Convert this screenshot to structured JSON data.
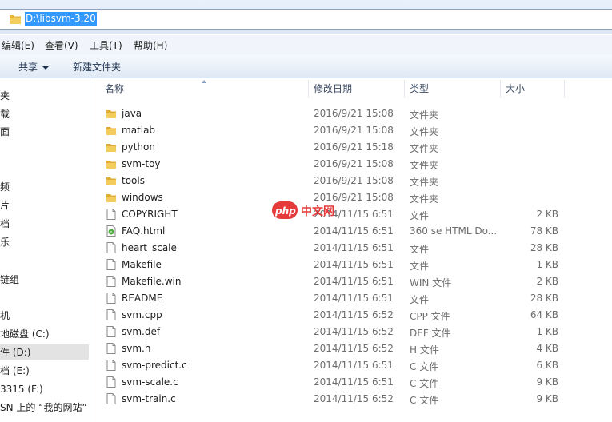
{
  "address": {
    "path": "D:\\libsvm-3.20"
  },
  "menu": [
    "编辑(E)",
    "查看(V)",
    "工具(T)",
    "帮助(H)"
  ],
  "toolbar": {
    "share_label": "共享",
    "new_folder_label": "新建文件夹"
  },
  "nav": [
    "夹",
    "载",
    "面",
    "频",
    "片",
    "档",
    "乐",
    "链组",
    "机",
    "地磁盘 (C:)",
    "件 (D:)",
    "档 (E:)",
    "3315 (F:)",
    "SN 上的 “我的网站”"
  ],
  "columns": {
    "name": "名称",
    "date": "修改日期",
    "type": "类型",
    "size": "大小"
  },
  "files": [
    {
      "name": "java",
      "date": "2016/9/21 15:08",
      "type": "文件夹",
      "size": "",
      "icon": "folder-icon"
    },
    {
      "name": "matlab",
      "date": "2016/9/21 15:08",
      "type": "文件夹",
      "size": "",
      "icon": "folder-icon"
    },
    {
      "name": "python",
      "date": "2016/9/21 15:18",
      "type": "文件夹",
      "size": "",
      "icon": "folder-icon"
    },
    {
      "name": "svm-toy",
      "date": "2016/9/21 15:08",
      "type": "文件夹",
      "size": "",
      "icon": "folder-icon"
    },
    {
      "name": "tools",
      "date": "2016/9/21 15:08",
      "type": "文件夹",
      "size": "",
      "icon": "folder-icon"
    },
    {
      "name": "windows",
      "date": "2016/9/21 15:08",
      "type": "文件夹",
      "size": "",
      "icon": "folder-icon"
    },
    {
      "name": "COPYRIGHT",
      "date": "2014/11/15 6:51",
      "type": "文件",
      "size": "2 KB",
      "icon": "file-icon"
    },
    {
      "name": "FAQ.html",
      "date": "2014/11/15 6:51",
      "type": "360 se HTML Do...",
      "size": "78 KB",
      "icon": "html-file-icon"
    },
    {
      "name": "heart_scale",
      "date": "2014/11/15 6:51",
      "type": "文件",
      "size": "28 KB",
      "icon": "file-icon"
    },
    {
      "name": "Makefile",
      "date": "2014/11/15 6:51",
      "type": "文件",
      "size": "1 KB",
      "icon": "file-icon"
    },
    {
      "name": "Makefile.win",
      "date": "2014/11/15 6:51",
      "type": "WIN 文件",
      "size": "2 KB",
      "icon": "file-icon"
    },
    {
      "name": "README",
      "date": "2014/11/15 6:51",
      "type": "文件",
      "size": "28 KB",
      "icon": "file-icon"
    },
    {
      "name": "svm.cpp",
      "date": "2014/11/15 6:52",
      "type": "CPP 文件",
      "size": "64 KB",
      "icon": "file-icon"
    },
    {
      "name": "svm.def",
      "date": "2014/11/15 6:52",
      "type": "DEF 文件",
      "size": "1 KB",
      "icon": "file-icon"
    },
    {
      "name": "svm.h",
      "date": "2014/11/15 6:52",
      "type": "H 文件",
      "size": "4 KB",
      "icon": "file-icon"
    },
    {
      "name": "svm-predict.c",
      "date": "2014/11/15 6:51",
      "type": "C 文件",
      "size": "6 KB",
      "icon": "file-icon"
    },
    {
      "name": "svm-scale.c",
      "date": "2014/11/15 6:51",
      "type": "C 文件",
      "size": "9 KB",
      "icon": "file-icon"
    },
    {
      "name": "svm-train.c",
      "date": "2014/11/15 6:52",
      "type": "C 文件",
      "size": "9 KB",
      "icon": "file-icon"
    }
  ],
  "watermark": {
    "logo": "php",
    "text": "中文网"
  },
  "colors": {
    "selection": "#3399ff",
    "folder": "#f0c04a",
    "watermark": "#e63a3a"
  }
}
